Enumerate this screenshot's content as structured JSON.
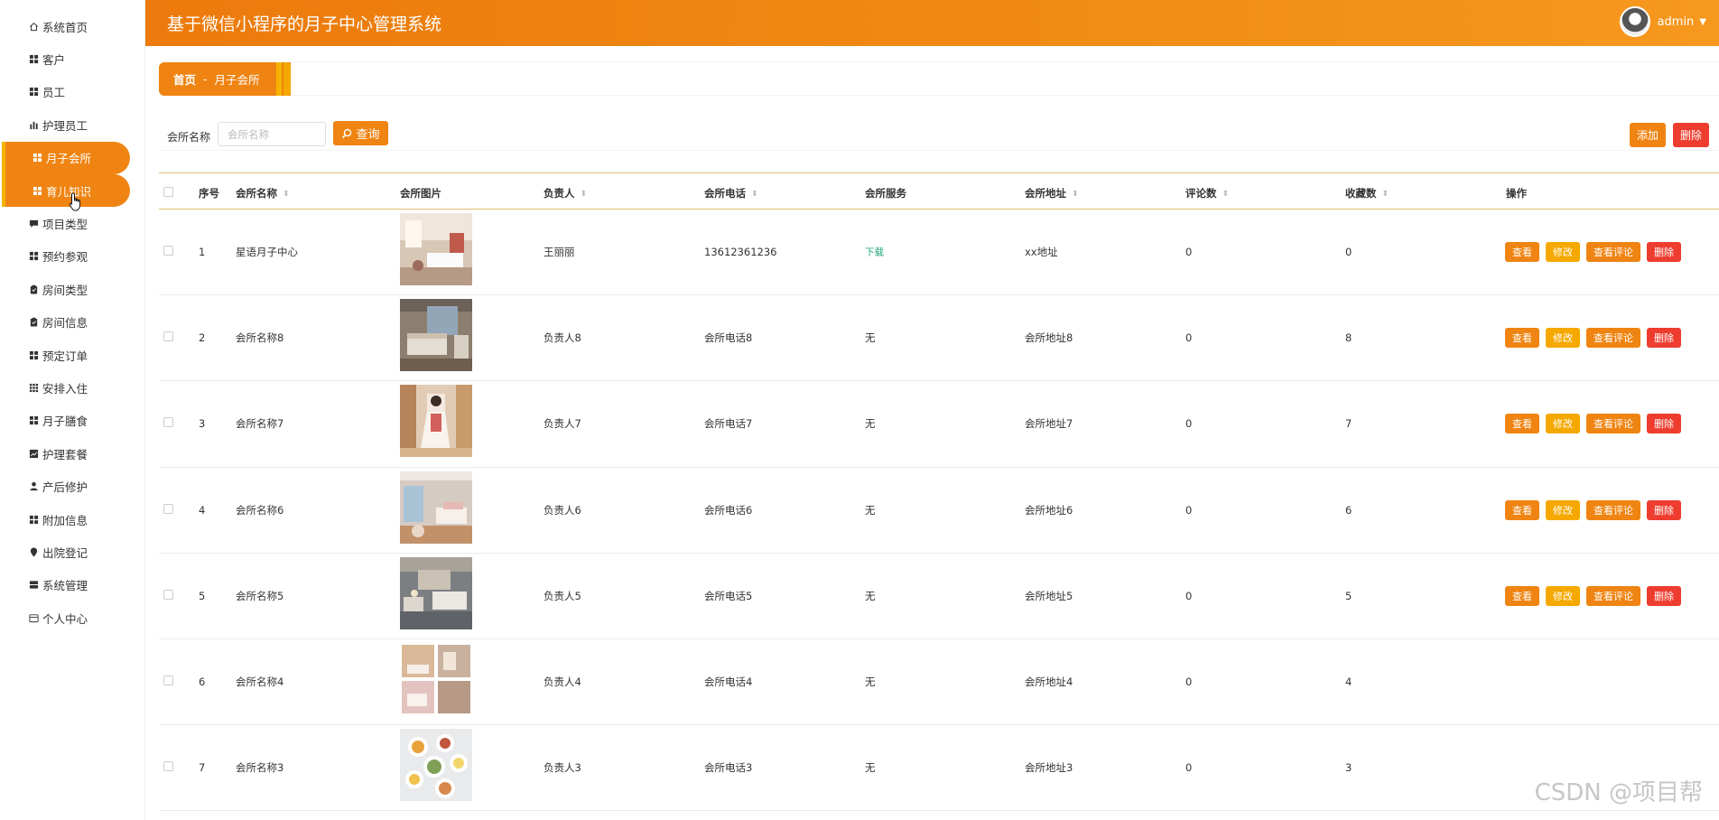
{
  "app": {
    "title": "基于微信小程序的月子中心管理系统"
  },
  "user": {
    "name": "admin"
  },
  "sidebar": {
    "items": [
      {
        "label": "系统首页",
        "icon": "home-icon",
        "active": false
      },
      {
        "label": "客户",
        "icon": "grid-icon",
        "active": false
      },
      {
        "label": "员工",
        "icon": "grid-icon",
        "active": false
      },
      {
        "label": "护理员工",
        "icon": "bar-chart-icon",
        "active": false
      },
      {
        "label": "月子会所",
        "icon": "grid-icon",
        "active": true
      },
      {
        "label": "育儿知识",
        "icon": "grid-icon",
        "active": true
      },
      {
        "label": "项目类型",
        "icon": "chat-icon",
        "active": false
      },
      {
        "label": "预约参观",
        "icon": "grid-icon",
        "active": false
      },
      {
        "label": "房间类型",
        "icon": "clipboard-icon",
        "active": false
      },
      {
        "label": "房间信息",
        "icon": "clipboard-icon",
        "active": false
      },
      {
        "label": "预定订单",
        "icon": "grid-icon",
        "active": false
      },
      {
        "label": "安排入住",
        "icon": "apps-icon",
        "active": false
      },
      {
        "label": "月子膳食",
        "icon": "grid-icon",
        "active": false
      },
      {
        "label": "护理套餐",
        "icon": "chart-box-icon",
        "active": false
      },
      {
        "label": "产后修护",
        "icon": "person-icon",
        "active": false
      },
      {
        "label": "附加信息",
        "icon": "grid-icon",
        "active": false
      },
      {
        "label": "出院登记",
        "icon": "location-icon",
        "active": false
      },
      {
        "label": "系统管理",
        "icon": "server-icon",
        "active": false
      },
      {
        "label": "个人中心",
        "icon": "card-icon",
        "active": false
      }
    ]
  },
  "breadcrumb": {
    "home": "首页",
    "separator": "-",
    "current": "月子会所"
  },
  "search": {
    "label": "会所名称",
    "placeholder": "会所名称",
    "button": "查询"
  },
  "actions": {
    "add": "添加",
    "delete": "删除"
  },
  "table": {
    "headers": {
      "index": "序号",
      "name": "会所名称",
      "image": "会所图片",
      "manager": "负责人",
      "phone": "会所电话",
      "service": "会所服务",
      "address": "会所地址",
      "comments": "评论数",
      "favorites": "收藏数",
      "ops": "操作"
    },
    "op_labels": {
      "view": "查看",
      "edit": "修改",
      "comments": "查看评论",
      "delete": "删除"
    },
    "rows": [
      {
        "index": "1",
        "name": "星语月子中心",
        "manager": "王丽丽",
        "phone": "13612361236",
        "service": "下载",
        "address": "xx地址",
        "comments": "0",
        "favorites": "0",
        "image_hint": "lobby"
      },
      {
        "index": "2",
        "name": "会所名称8",
        "manager": "负责人8",
        "phone": "会所电话8",
        "service": "无",
        "address": "会所地址8",
        "comments": "0",
        "favorites": "8",
        "image_hint": "bedroom"
      },
      {
        "index": "3",
        "name": "会所名称7",
        "manager": "负责人7",
        "phone": "会所电话7",
        "service": "无",
        "address": "会所地址7",
        "comments": "0",
        "favorites": "7",
        "image_hint": "person"
      },
      {
        "index": "4",
        "name": "会所名称6",
        "manager": "负责人6",
        "phone": "会所电话6",
        "service": "无",
        "address": "会所地址6",
        "comments": "0",
        "favorites": "6",
        "image_hint": "room"
      },
      {
        "index": "5",
        "name": "会所名称5",
        "manager": "负责人5",
        "phone": "会所电话5",
        "service": "无",
        "address": "会所地址5",
        "comments": "0",
        "favorites": "5",
        "image_hint": "suite"
      },
      {
        "index": "6",
        "name": "会所名称4",
        "manager": "负责人4",
        "phone": "会所电话4",
        "service": "无",
        "address": "会所地址4",
        "comments": "0",
        "favorites": "4",
        "image_hint": "collage"
      },
      {
        "index": "7",
        "name": "会所名称3",
        "manager": "负责人3",
        "phone": "会所电话3",
        "service": "无",
        "address": "会所地址3",
        "comments": "0",
        "favorites": "3",
        "image_hint": "food"
      }
    ]
  },
  "watermark": "CSDN @项目帮",
  "colors": {
    "accent": "#ef8412",
    "accent_yellow": "#f5a800",
    "danger": "#ee3d2f",
    "service_link": "#1fa67a"
  }
}
